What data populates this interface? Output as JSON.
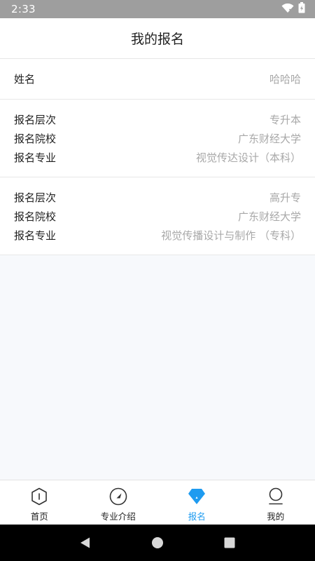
{
  "status_bar": {
    "time": "2:33"
  },
  "header": {
    "title": "我的报名"
  },
  "profile": {
    "name_label": "姓名",
    "name_value": "哈哈哈"
  },
  "registrations": [
    {
      "level_label": "报名层次",
      "level_value": "专升本",
      "school_label": "报名院校",
      "school_value": "广东财经大学",
      "major_label": "报名专业",
      "major_value": "视觉传达设计（本科）"
    },
    {
      "level_label": "报名层次",
      "level_value": "高升专",
      "school_label": "报名院校",
      "school_value": "广东财经大学",
      "major_label": "报名专业",
      "major_value": "视觉传播设计与制作 （专科）"
    }
  ],
  "tabs": [
    {
      "label": "首页",
      "icon": "home-hexagon-icon",
      "active": false
    },
    {
      "label": "专业介绍",
      "icon": "compass-icon",
      "active": false
    },
    {
      "label": "报名",
      "icon": "signup-diamond-icon",
      "active": true
    },
    {
      "label": "我的",
      "icon": "user-profile-icon",
      "active": false
    }
  ],
  "colors": {
    "accent": "#1e9bf0",
    "value_text": "#a8a8a8",
    "status_bar": "#9e9e9e"
  }
}
